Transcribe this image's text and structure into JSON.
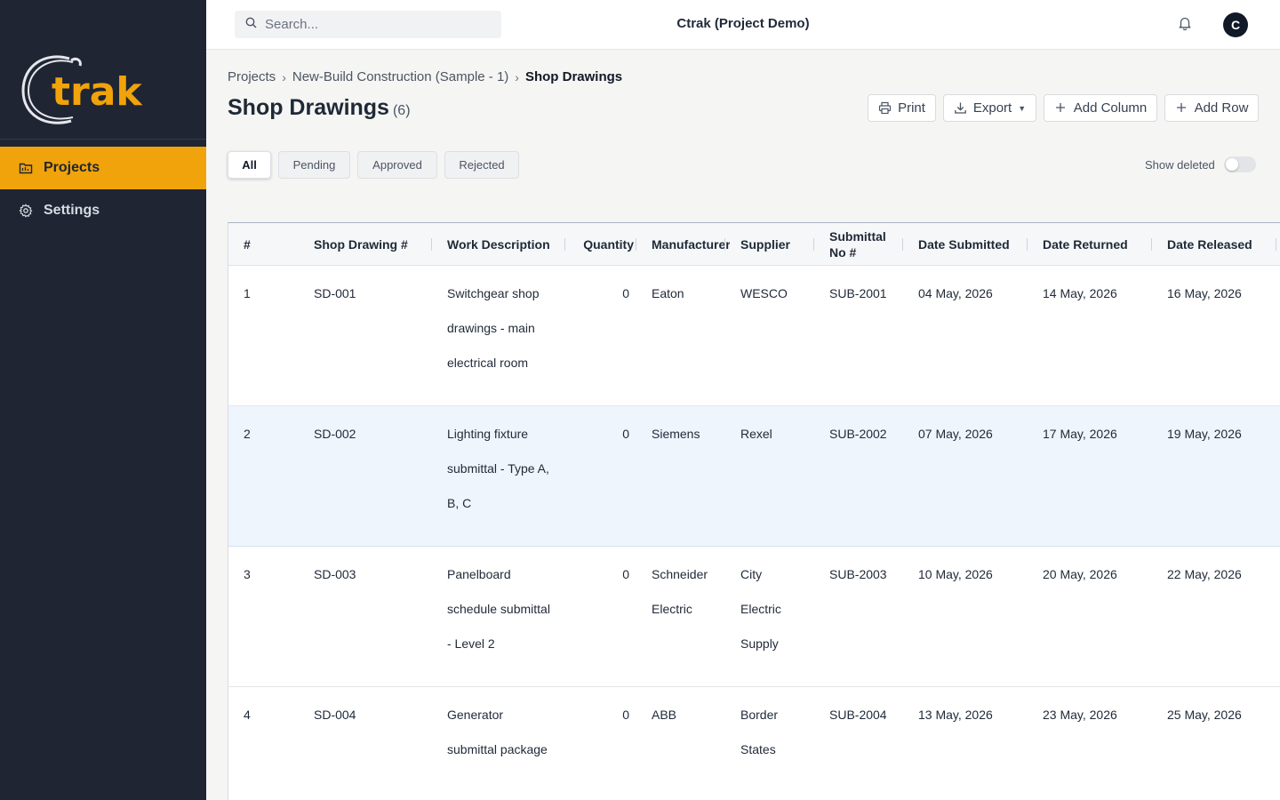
{
  "app": {
    "title": "Ctrak (Project Demo)",
    "logo_text": "trak",
    "avatar_initial": "C"
  },
  "colors": {
    "sidebar_bg": "#1f2533",
    "accent": "#f0a30a",
    "row_highlight": "#eef5fd"
  },
  "sidebar": {
    "items": [
      {
        "label": "Projects",
        "icon": "folder-icon",
        "active": true
      },
      {
        "label": "Settings",
        "icon": "gear-icon",
        "active": false
      }
    ]
  },
  "search": {
    "placeholder": "Search...",
    "value": ""
  },
  "breadcrumb": [
    "Projects",
    "New-Build Construction (Sample - 1)",
    "Shop Drawings"
  ],
  "page": {
    "title": "Shop Drawings",
    "count": "(6)"
  },
  "toolbar": {
    "print": "Print",
    "export": "Export",
    "add_column": "Add Column",
    "add_row": "Add Row"
  },
  "tabs": [
    "All",
    "Pending",
    "Approved",
    "Rejected"
  ],
  "show_deleted": {
    "label": "Show deleted",
    "enabled": false
  },
  "table": {
    "columns": [
      "#",
      "Shop Drawing #",
      "Work Description",
      "Quantity",
      "Manufacturer",
      "Supplier",
      "Submittal\nNo #",
      "Date Submitted",
      "Date Returned",
      "Date Released"
    ],
    "rows": [
      {
        "num": "1",
        "sd": "SD-001",
        "desc": [
          "Switchgear shop",
          "drawings - main",
          "electrical room"
        ],
        "qty": "0",
        "mfr": [
          "Eaton"
        ],
        "supplier": [
          "WESCO"
        ],
        "submittal": "SUB-2001",
        "submitted": "04 May, 2026",
        "returned": "14 May, 2026",
        "released": "16 May, 2026"
      },
      {
        "num": "2",
        "sd": "SD-002",
        "desc": [
          "Lighting fixture",
          "submittal - Type A,",
          "B, C"
        ],
        "qty": "0",
        "mfr": [
          "Siemens"
        ],
        "supplier": [
          "Rexel"
        ],
        "submittal": "SUB-2002",
        "submitted": "07 May, 2026",
        "returned": "17 May, 2026",
        "released": "19 May, 2026"
      },
      {
        "num": "3",
        "sd": "SD-003",
        "desc": [
          "Panelboard",
          "schedule submittal",
          "- Level 2"
        ],
        "qty": "0",
        "mfr": [
          "Schneider",
          "Electric"
        ],
        "supplier": [
          "City",
          "Electric",
          "Supply"
        ],
        "submittal": "SUB-2003",
        "submitted": "10 May, 2026",
        "returned": "20 May, 2026",
        "released": "22 May, 2026"
      },
      {
        "num": "4",
        "sd": "SD-004",
        "desc": [
          "Generator",
          "submittal package"
        ],
        "qty": "0",
        "mfr": [
          "ABB"
        ],
        "supplier": [
          "Border",
          "States"
        ],
        "submittal": "SUB-2004",
        "submitted": "13 May, 2026",
        "returned": "23 May, 2026",
        "released": "25 May, 2026"
      }
    ]
  }
}
